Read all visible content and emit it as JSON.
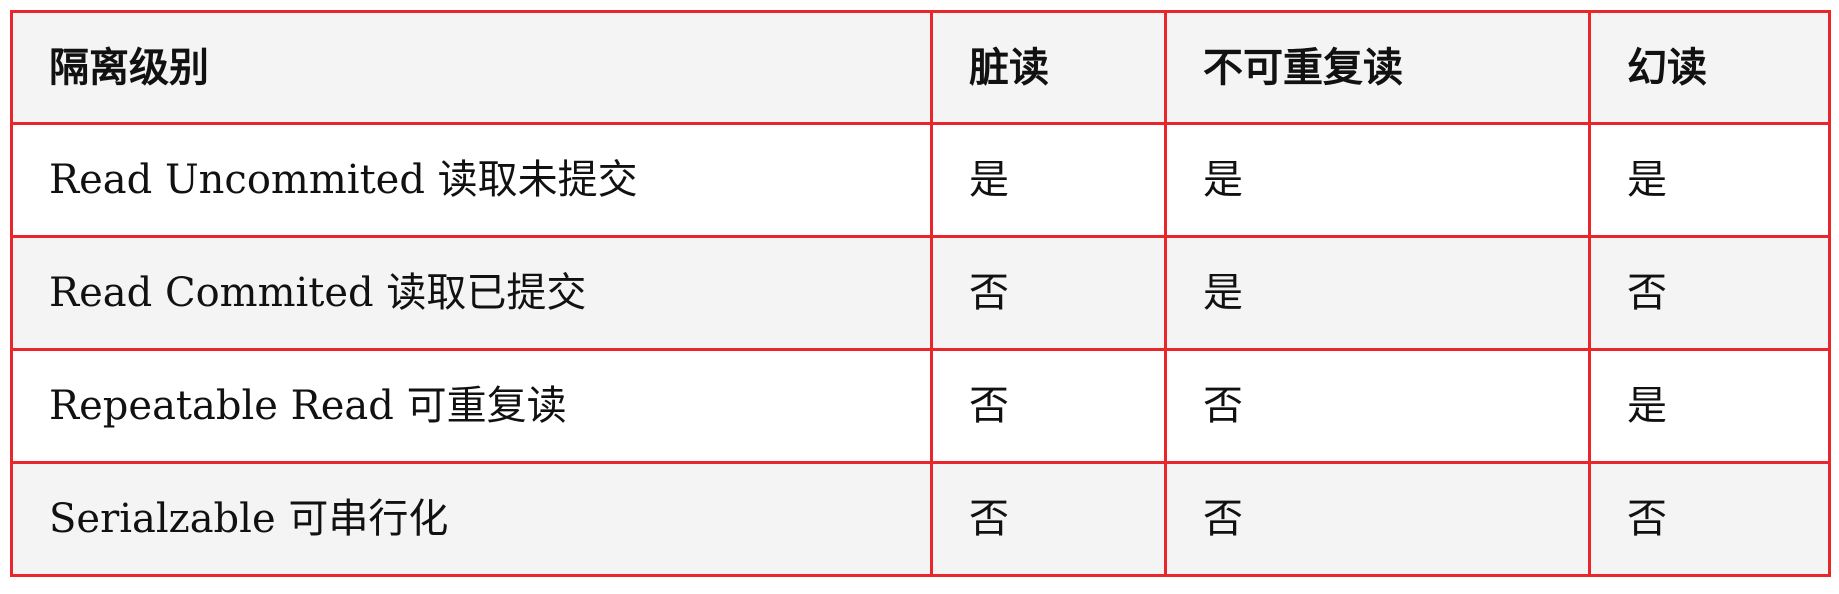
{
  "table": {
    "headers": [
      "隔离级别",
      "脏读",
      "不可重复读",
      "幻读"
    ],
    "rows": [
      [
        "Read Uncommited 读取未提交",
        "是",
        "是",
        "是"
      ],
      [
        "Read Commited 读取已提交",
        "否",
        "是",
        "否"
      ],
      [
        "Repeatable Read 可重复读",
        "否",
        "否",
        "是"
      ],
      [
        "Serialzable 可串行化",
        "否",
        "否",
        "否"
      ]
    ]
  },
  "colors": {
    "border": "#e8262b",
    "header_bg": "#f4f4f4",
    "alt_row_bg": "#f4f4f4",
    "row_bg": "#ffffff",
    "text": "#111111"
  }
}
